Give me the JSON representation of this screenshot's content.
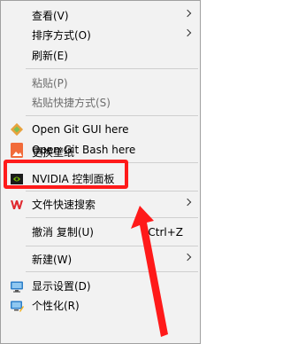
{
  "menu": {
    "view": "查看(V)",
    "sort_by": "排序方式(O)",
    "refresh": "刷新(E)",
    "paste": "粘贴(P)",
    "paste_shortcut": "粘贴快捷方式(S)",
    "git_gui": "Open Git GUI here",
    "git_bash": "Open Git Bash here",
    "change_wallpaper": "更换壁纸",
    "nvidia": "NVIDIA 控制面板",
    "file_search": "文件快速搜索",
    "undo_copy": "撤消 复制(U)",
    "undo_copy_shortcut": "Ctrl+Z",
    "new": "新建(W)",
    "display_settings": "显示设置(D)",
    "personalize": "个性化(R)"
  },
  "colors": {
    "highlight": "#ff1a1a",
    "menu_background": "#f2f2f2",
    "disabled_text": "#6d6d6d"
  },
  "icons": {
    "git_gui": "git-diamond-icon",
    "git_bash": "git-diamond-icon",
    "wallpaper": "wallpaper-icon",
    "nvidia": "nvidia-icon",
    "file_search": "wps-icon",
    "display_settings": "monitor-icon",
    "personalize": "personalize-icon"
  }
}
